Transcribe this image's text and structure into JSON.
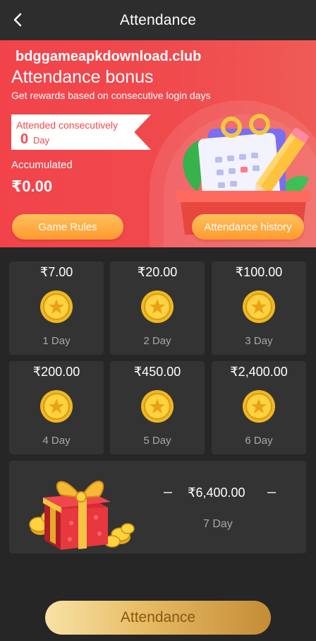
{
  "header": {
    "title": "Attendance"
  },
  "banner": {
    "site_name": "bdggameapkdownload.club",
    "title": "Attendance bonus",
    "subtitle": "Get rewards based on consecutive login days",
    "consecutive_label": "Attended consecutively",
    "consecutive_count": "0",
    "consecutive_unit": "Day",
    "accumulated_label": "Accumulated",
    "accumulated_value": "₹0.00",
    "rules_button": "Game Rules",
    "history_button": "Attendance history"
  },
  "days": [
    {
      "amount": "₹7.00",
      "label": "1 Day"
    },
    {
      "amount": "₹20.00",
      "label": "2 Day"
    },
    {
      "amount": "₹100.00",
      "label": "3 Day"
    },
    {
      "amount": "₹200.00",
      "label": "4 Day"
    },
    {
      "amount": "₹450.00",
      "label": "5 Day"
    },
    {
      "amount": "₹2,400.00",
      "label": "6 Day"
    }
  ],
  "day7": {
    "amount": "₹6,400.00",
    "label": "7 Day"
  },
  "attendance_button": "Attendance",
  "icons": {
    "back": "back-arrow-icon",
    "coin": "coin-icon",
    "gift": "gift-icon",
    "calendar": "calendar-pencil-icon"
  },
  "colors": {
    "banner_red": "#f04a4d",
    "gold": "#e6bb62",
    "card": "#333333",
    "background": "#262626"
  }
}
